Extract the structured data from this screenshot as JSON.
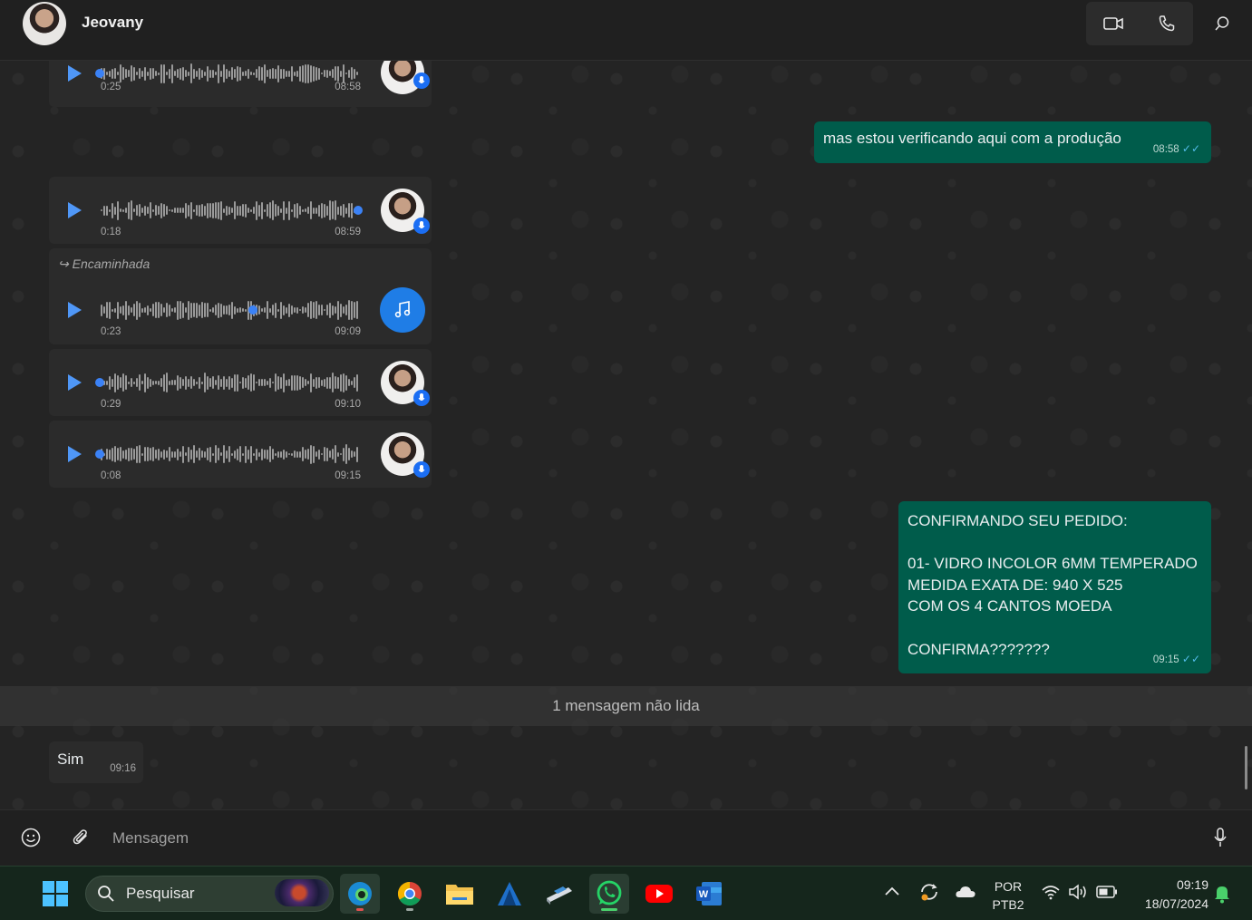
{
  "header": {
    "contact_name": "Jeovany",
    "icons": [
      "video-icon",
      "phone-icon",
      "search-icon"
    ]
  },
  "voice_messages": [
    {
      "duration": "0:25",
      "time": "08:58",
      "progress": 0.0
    },
    {
      "duration": "0:18",
      "time": "08:59",
      "progress": 1.0
    },
    {
      "forwarded_label": "Encaminhada",
      "duration": "0:23",
      "time": "09:09",
      "progress": 0.6,
      "avatar_icon": "music-note-icon"
    },
    {
      "duration": "0:29",
      "time": "09:10",
      "progress": 0.0
    },
    {
      "duration": "0:08",
      "time": "09:15",
      "progress": 0.0
    }
  ],
  "outgoing": [
    {
      "text": "mas estou verificando aqui com a produção",
      "time": "08:58"
    },
    {
      "lines": [
        "CONFIRMANDO SEU PEDIDO:",
        "",
        "01- VIDRO INCOLOR 6MM TEMPERADO",
        "MEDIDA EXATA DE: 940 X 525",
        "COM OS 4 CANTOS MOEDA",
        "",
        "CONFIRMA???????"
      ],
      "time": "09:15"
    }
  ],
  "unread_label": "1 mensagem não lida",
  "incoming": {
    "text": "Sim",
    "time": "09:16"
  },
  "composer": {
    "placeholder": "Mensagem"
  },
  "taskbar": {
    "search_label": "Pesquisar",
    "language_line1": "POR",
    "language_line2": "PTB2",
    "clock_time": "09:19",
    "clock_date": "18/07/2024"
  },
  "colors": {
    "outgoing_bubble": "#005c4b",
    "accent_blue": "#3b82f6",
    "tick_blue": "#53bdeb"
  }
}
